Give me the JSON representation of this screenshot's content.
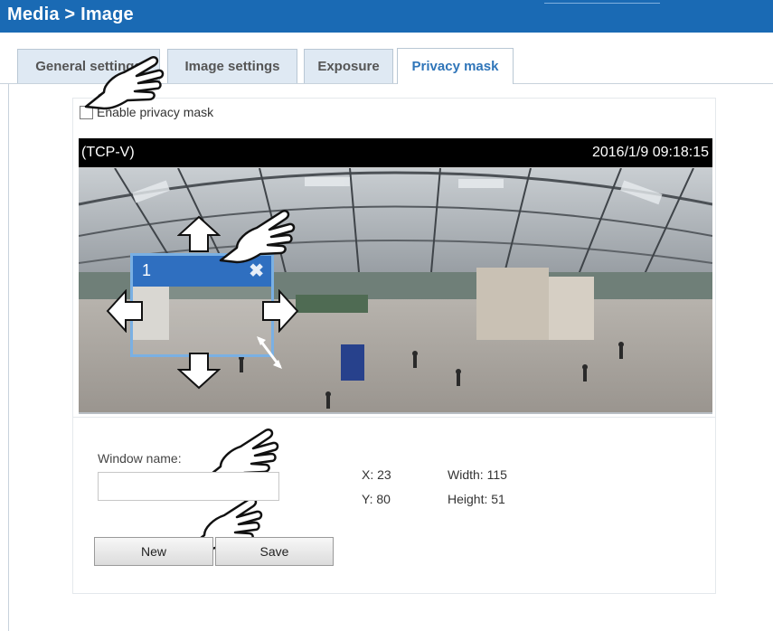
{
  "header": {
    "title": "Media > Image"
  },
  "tabs": [
    {
      "label": "General settings"
    },
    {
      "label": "Image settings"
    },
    {
      "label": "Exposure"
    },
    {
      "label": "Privacy mask"
    }
  ],
  "active_tab": "Privacy mask",
  "privacy": {
    "enable_label": "Enable privacy mask",
    "enabled": false
  },
  "video": {
    "stream": "(TCP-V)",
    "timestamp": "2016/1/9 09:18:15"
  },
  "mask_window": {
    "id": "1",
    "close_glyph": "✖"
  },
  "form": {
    "window_name_label": "Window name:",
    "window_name_value": "",
    "x_label": "X: 23",
    "y_label": "Y: 80",
    "width_label": "Width: 115",
    "height_label": "Height: 51",
    "new_label": "New",
    "save_label": "Save"
  },
  "colors": {
    "header_bg": "#1a6ab4",
    "tab_bg": "#dfe9f3",
    "active_tab_text": "#2f75b9",
    "mask_header": "#2f6fc0",
    "mask_border": "#7ab0e3"
  },
  "icons": [
    "pointing-hand-icon",
    "arrow-up-icon",
    "arrow-down-icon",
    "arrow-left-icon",
    "arrow-right-icon",
    "resize-arrow-icon",
    "close-icon"
  ]
}
